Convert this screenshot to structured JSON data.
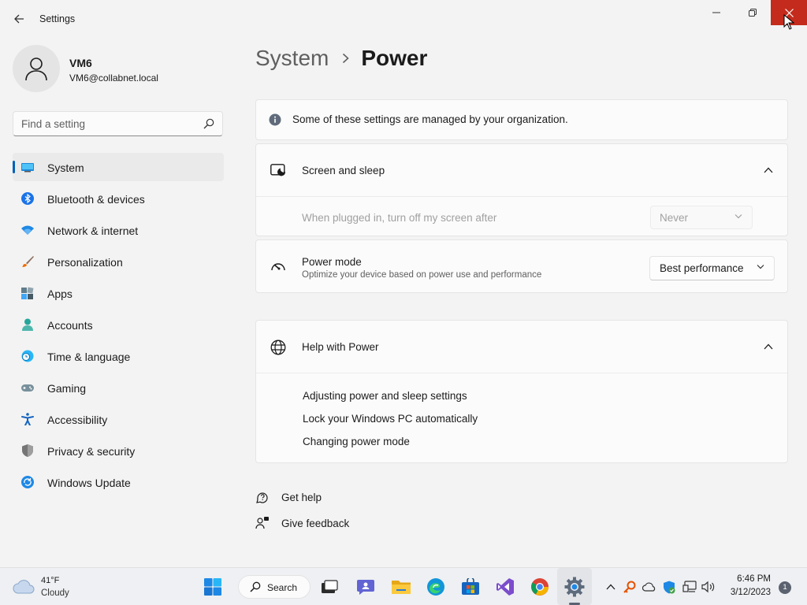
{
  "window": {
    "title": "Settings",
    "controls": {
      "minimize": "minimize-icon",
      "maximize": "restore-icon",
      "close": "close-icon"
    }
  },
  "profile": {
    "name": "VM6",
    "email": "VM6@collabnet.local"
  },
  "search": {
    "placeholder": "Find a setting"
  },
  "sidebar": {
    "items": [
      {
        "label": "System",
        "icon": "system-icon",
        "active": true
      },
      {
        "label": "Bluetooth & devices",
        "icon": "bluetooth-icon"
      },
      {
        "label": "Network & internet",
        "icon": "wifi-icon"
      },
      {
        "label": "Personalization",
        "icon": "brush-icon"
      },
      {
        "label": "Apps",
        "icon": "apps-icon"
      },
      {
        "label": "Accounts",
        "icon": "person-icon"
      },
      {
        "label": "Time & language",
        "icon": "globe-clock-icon"
      },
      {
        "label": "Gaming",
        "icon": "gamepad-icon"
      },
      {
        "label": "Accessibility",
        "icon": "accessibility-icon"
      },
      {
        "label": "Privacy & security",
        "icon": "shield-icon"
      },
      {
        "label": "Windows Update",
        "icon": "update-icon"
      }
    ]
  },
  "breadcrumb": {
    "parent": "System",
    "current": "Power"
  },
  "info_banner": {
    "text": "Some of these settings are managed by your organization."
  },
  "screen_sleep": {
    "title": "Screen and sleep",
    "setting_label": "When plugged in, turn off my screen after",
    "setting_value": "Never"
  },
  "power_mode": {
    "title": "Power mode",
    "description": "Optimize your device based on power use and performance",
    "value": "Best performance"
  },
  "help": {
    "title": "Help with Power",
    "links": [
      "Adjusting power and sleep settings",
      "Lock your Windows PC automatically",
      "Changing power mode"
    ]
  },
  "footer": {
    "get_help": "Get help",
    "give_feedback": "Give feedback"
  },
  "taskbar": {
    "weather_temp": "41°F",
    "weather_desc": "Cloudy",
    "search_label": "Search",
    "apps": [
      "start-icon",
      "search-icon",
      "task-view-icon",
      "chat-icon",
      "file-explorer-icon",
      "edge-icon",
      "store-icon",
      "visual-studio-icon",
      "chrome-icon",
      "settings-icon"
    ],
    "clock_time": "6:46 PM",
    "clock_date": "3/12/2023",
    "notification_count": "1"
  },
  "colors": {
    "accent": "#005fb8",
    "close_button": "#c42b1c",
    "background": "#f3f3f3",
    "card": "#fbfbfb"
  }
}
